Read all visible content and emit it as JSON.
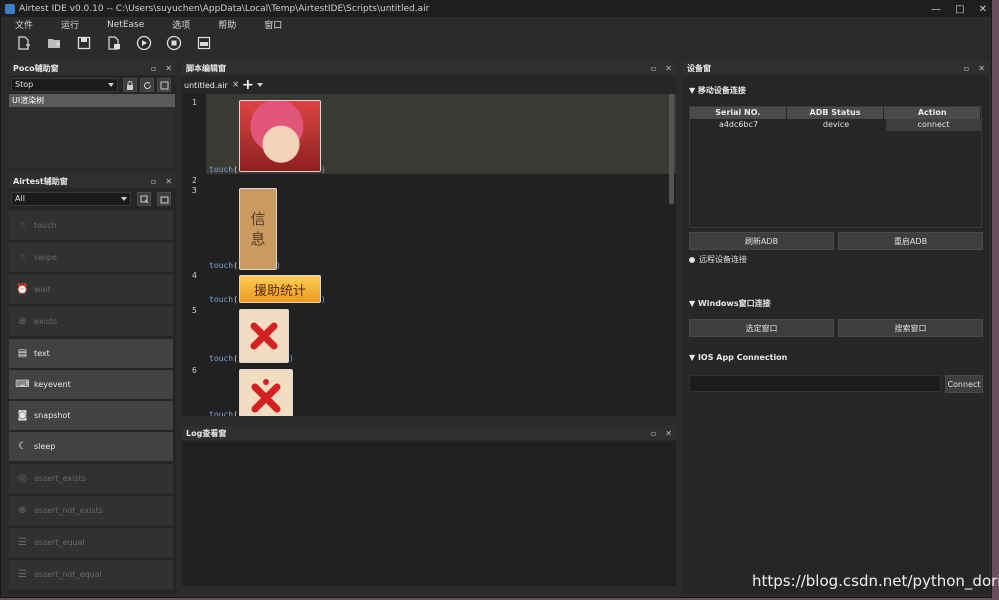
{
  "window": {
    "title": "Airtest IDE v0.0.10 -- C:\\Users\\suyuchen\\AppData\\Local\\Temp\\AirtestIDE\\Scripts\\untitled.air",
    "controls": {
      "minimize": "—",
      "maximize": "□",
      "close": "✕"
    }
  },
  "menu": [
    "文件",
    "运行",
    "NetEase",
    "选项",
    "帮助",
    "窗口"
  ],
  "toolbar_icons": [
    "new-file-icon",
    "open-folder-icon",
    "save-icon",
    "save-as-icon",
    "run-icon",
    "stop-icon",
    "log-icon"
  ],
  "poco_panel": {
    "title": "Poco辅助窗",
    "mode_select": "Stop",
    "tree_node": "UI渲染树"
  },
  "airtest_panel": {
    "title": "Airtest辅助窗",
    "filter_select": "All",
    "actions": [
      {
        "label": "touch",
        "icon": "hand-pointer-icon",
        "enabled": false
      },
      {
        "label": "swipe",
        "icon": "swipe-gesture-icon",
        "enabled": false
      },
      {
        "label": "wait",
        "icon": "alarm-clock-icon",
        "enabled": false
      },
      {
        "label": "exists",
        "icon": "magnifier-check-icon",
        "enabled": false
      },
      {
        "label": "text",
        "icon": "text-box-icon",
        "enabled": true
      },
      {
        "label": "keyevent",
        "icon": "keyboard-icon",
        "enabled": true
      },
      {
        "label": "snapshot",
        "icon": "camera-icon",
        "enabled": true
      },
      {
        "label": "sleep",
        "icon": "moon-icon",
        "enabled": true
      },
      {
        "label": "assert_exists",
        "icon": "target-icon",
        "enabled": false
      },
      {
        "label": "assert_not_exists",
        "icon": "target-x-icon",
        "enabled": false
      },
      {
        "label": "assert_equal",
        "icon": "equal-stack-icon",
        "enabled": false
      },
      {
        "label": "assert_not_equal",
        "icon": "not-equal-stack-icon",
        "enabled": false
      }
    ]
  },
  "editor_panel": {
    "title": "脚本编辑窗",
    "tab": "untitled.air",
    "tab_close": "×",
    "add_tab": "+",
    "line_numbers": [
      "1",
      "2",
      "3",
      "4",
      "5",
      "6"
    ],
    "code_fn": "touch",
    "code_open": "(",
    "code_close": ")",
    "thumbnail_texts": {
      "info": "信\n息",
      "assist_stats": "援助统计"
    }
  },
  "log_panel": {
    "title": "Log查看窗"
  },
  "device_panel": {
    "title": "设备窗",
    "mobile_section": "▼ 移动设备连接",
    "table_headers": [
      "Serial NO.",
      "ADB Status",
      "Action"
    ],
    "table_rows": [
      {
        "serial": "a4dc6bc7",
        "status": "device",
        "action": "connect"
      }
    ],
    "refresh_adb": "刷新ADB",
    "restart_adb": "重启ADB",
    "remote_connect": "远程设备连接",
    "windows_section": "▼ Windows窗口连接",
    "select_window": "选定窗口",
    "search_window": "搜索窗口",
    "ios_section": "▼ IOS App Connection",
    "ios_input_value": "",
    "ios_connect": "Connect"
  },
  "watermark": "https://blog.csdn.net/python_doris",
  "colors": {
    "accent_red": "#c0392b",
    "thumb_gold": "#f0b030",
    "link_blue": "#7aa6d6"
  }
}
